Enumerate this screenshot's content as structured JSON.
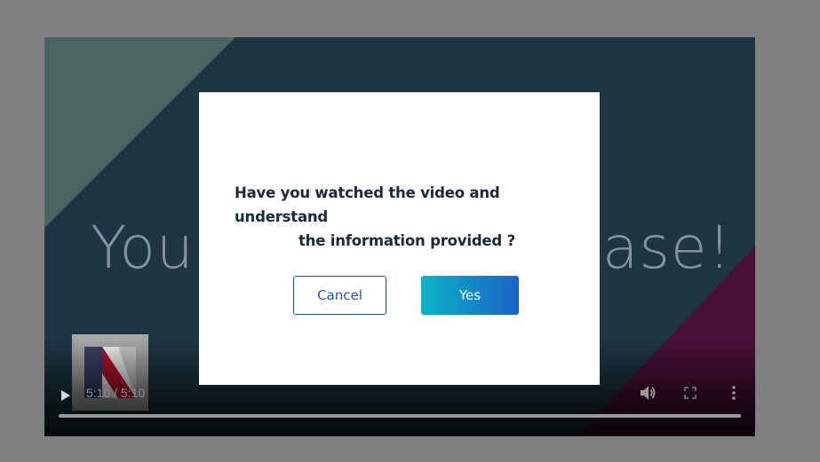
{
  "video": {
    "title_left": "You",
    "title_right": "ase!",
    "time": "5:10 / 5:10",
    "progress": 1.0,
    "icons": {
      "play": "play-icon",
      "volume": "volume-icon",
      "fullscreen": "fullscreen-icon",
      "more": "more-vertical-icon"
    }
  },
  "dialog": {
    "message_line_1": "Have you watched the video and",
    "message_line_2": "understand",
    "message_line_3": "the information provided ?",
    "cancel_label": "Cancel",
    "yes_label": "Yes"
  },
  "colors": {
    "dialog_text": "#1b2a3a",
    "cancel_border": "#2b4e9a",
    "yes_gradient_start": "#0db3c8",
    "yes_gradient_end": "#1a62c6",
    "page_backdrop": "#808080"
  }
}
